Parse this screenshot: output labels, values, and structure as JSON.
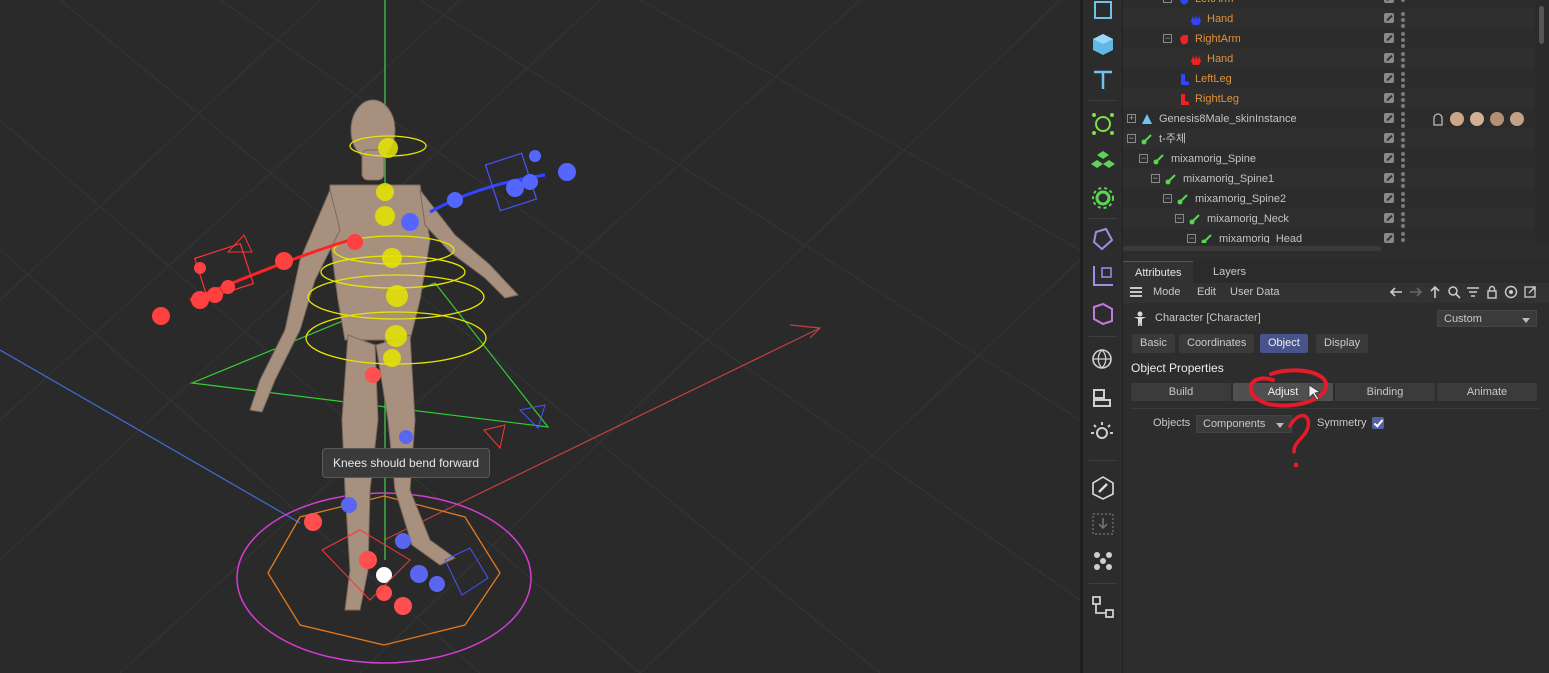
{
  "viewport": {
    "tooltip": "Knees should bend forward"
  },
  "toolbar": {
    "buttons": [
      "cube-outline-icon",
      "cube-icon",
      "text-icon",
      "spline-icon",
      "cloner-icon",
      "generator-icon",
      "deformer-icon",
      "camera-icon",
      "scene-icon",
      "light-icon",
      "edit-icon",
      "snap-icon",
      "points-icon",
      "flow-icon"
    ]
  },
  "object_tree": {
    "rows": [
      {
        "label": "LeftArm",
        "color": "orange",
        "indent": 3
      },
      {
        "label": "Hand",
        "color": "orange",
        "indent": 4
      },
      {
        "label": "RightArm",
        "color": "orange",
        "indent": 3
      },
      {
        "label": "Hand",
        "color": "orange",
        "indent": 4
      },
      {
        "label": "LeftLeg",
        "color": "orange",
        "indent": 3
      },
      {
        "label": "RightLeg",
        "color": "orange",
        "indent": 3
      },
      {
        "label": "Genesis8Male_skinInstance",
        "color": "grey",
        "indent": 0
      },
      {
        "label": "t-주체",
        "color": "grey",
        "indent": 0
      },
      {
        "label": "mixamorig_Spine",
        "color": "grey",
        "indent": 1
      },
      {
        "label": "mixamorig_Spine1",
        "color": "grey",
        "indent": 2
      },
      {
        "label": "mixamorig_Spine2",
        "color": "grey",
        "indent": 3
      },
      {
        "label": "mixamorig_Neck",
        "color": "grey",
        "indent": 4
      },
      {
        "label": "mixamorig_Head",
        "color": "grey",
        "indent": 5
      }
    ]
  },
  "panel": {
    "tabs": [
      "Attributes",
      "Layers"
    ],
    "menu": [
      "Mode",
      "Edit",
      "User Data"
    ],
    "object_title": "Character [Character]",
    "preset": "Custom",
    "subtabs": [
      "Basic",
      "Coordinates",
      "Object",
      "Display"
    ],
    "section_title": "Object Properties",
    "mode_tabs": [
      "Build",
      "Adjust",
      "Binding",
      "Animate"
    ],
    "objects_label": "Objects",
    "objects_value": "Components",
    "symmetry_label": "Symmetry",
    "symmetry_checked": true
  },
  "colors": {
    "accent": "#47538a",
    "orange_label": "#e0913b"
  }
}
